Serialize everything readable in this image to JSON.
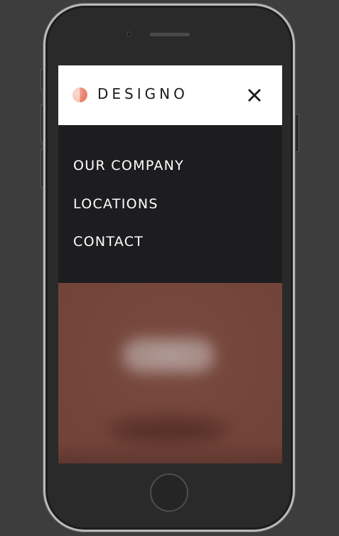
{
  "brand": {
    "name": "DESIGNO",
    "logo_colors": [
      "#f7c6b7",
      "#e7816b"
    ]
  },
  "header": {
    "close_icon": "close-icon"
  },
  "nav": {
    "items": [
      {
        "label": "OUR COMPANY"
      },
      {
        "label": "LOCATIONS"
      },
      {
        "label": "CONTACT"
      }
    ]
  },
  "colors": {
    "nav_background": "#1d1c1f",
    "header_background": "#ffffff",
    "hero_background": "#7a4a3f",
    "device_background": "#3d3d3d"
  }
}
